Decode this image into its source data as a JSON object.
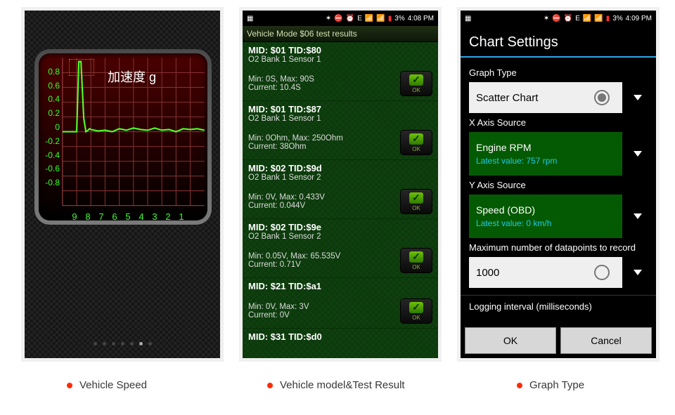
{
  "status": {
    "left": "",
    "icons": [
      "✶",
      "⛔",
      "⏰",
      "E",
      "📶",
      "📶",
      "3%"
    ],
    "time1": "4:08 PM",
    "time2": "4:09 PM"
  },
  "captions": {
    "c1": "Vehicle Speed",
    "c2": "Vehicle model&Test Result",
    "c3": "Graph Type"
  },
  "chart_data": {
    "type": "line",
    "title": "加速度 g",
    "xlabel": "",
    "ylabel": "",
    "xticks": [
      9,
      8,
      7,
      6,
      5,
      4,
      3,
      2,
      1
    ],
    "yticks": [
      0.8,
      0.6,
      0.4,
      0.2,
      0,
      -0.2,
      -0.4,
      -0.6,
      -0.8
    ],
    "xlim": [
      0,
      10
    ],
    "ylim": [
      -1,
      1
    ],
    "x": [
      10,
      9.0,
      8.85,
      8.7,
      8.5,
      8.35,
      8.2,
      8.1,
      8,
      7.5,
      7,
      6.5,
      6,
      5.5,
      5,
      4.5,
      4,
      3.5,
      3,
      2.5,
      2,
      1.5,
      1,
      0.5,
      0
    ],
    "y": [
      0.0,
      0.0,
      0.95,
      0.95,
      0.18,
      0.0,
      0.02,
      0.04,
      0.03,
      0.01,
      0.02,
      0.0,
      0.04,
      0.02,
      0.05,
      0.03,
      0.02,
      0.05,
      0.02,
      0.03,
      0.0,
      0.04,
      0.03,
      0.04,
      0.02
    ]
  },
  "mode06": {
    "header": "Vehicle Mode $06 test results",
    "ok_label": "OK",
    "items": [
      {
        "title": "MID: $01 TID:$80",
        "sensor": "O2 Bank 1 Sensor 1",
        "detail": "Min: 0S, Max: 90S\nCurrent: 10.4S"
      },
      {
        "title": "MID: $01 TID:$87",
        "sensor": "O2 Bank 1 Sensor 1",
        "detail": "Min: 0Ohm, Max: 250Ohm\nCurrent: 38Ohm"
      },
      {
        "title": "MID: $02 TID:$9d",
        "sensor": "O2 Bank 1 Sensor 2",
        "detail": "Min: 0V, Max: 0.433V\nCurrent: 0.044V"
      },
      {
        "title": "MID: $02 TID:$9e",
        "sensor": "O2 Bank 1 Sensor 2",
        "detail": "Min: 0.05V, Max: 65.535V\nCurrent: 0.71V"
      },
      {
        "title": "MID: $21 TID:$a1",
        "sensor": "",
        "detail": "Min: 0V, Max: 3V\nCurrent: 0V"
      },
      {
        "title": "MID: $31 TID:$d0",
        "sensor": "",
        "detail": ""
      }
    ]
  },
  "settings": {
    "title": "Chart Settings",
    "graphTypeLabel": "Graph Type",
    "graphType": "Scatter Chart",
    "xLabel": "X Axis Source",
    "xSource": "Engine RPM",
    "xLatest": "Latest value: 757 rpm",
    "yLabel": "Y Axis Source",
    "ySource": "Speed (OBD)",
    "yLatest": "Latest value: 0 km/h",
    "maxLabel": "Maximum number of datapoints to record",
    "maxValue": "1000",
    "intervalLabel": "Logging interval (milliseconds)",
    "ok": "OK",
    "cancel": "Cancel"
  }
}
